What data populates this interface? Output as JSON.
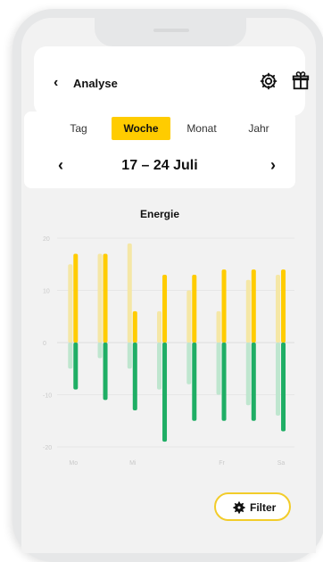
{
  "header": {
    "back_icon": "chevron-left-icon",
    "title": "Analyse",
    "settings_icon": "gear-icon",
    "gift_icon": "gift-icon"
  },
  "tabs": [
    {
      "label": "Tag",
      "active": false
    },
    {
      "label": "Woche",
      "active": true
    },
    {
      "label": "Monat",
      "active": false
    },
    {
      "label": "Jahr",
      "active": false
    }
  ],
  "range": {
    "prev_icon": "chevron-left-icon",
    "label": "17 – 24 Juli",
    "next_icon": "chevron-right-icon"
  },
  "chart_data": {
    "type": "bar",
    "title": "Energie",
    "yticks": [
      20,
      10,
      0,
      -10,
      -20
    ],
    "ylim": [
      -20,
      20
    ],
    "xlabels": [
      "Mo",
      "",
      "Mi",
      "",
      "",
      "Fr",
      "",
      "Sa"
    ],
    "categories": [
      "1",
      "2",
      "3",
      "4",
      "5",
      "6",
      "7",
      "8"
    ],
    "series": [
      {
        "values": [
          17,
          17,
          6,
          13,
          13,
          14,
          14,
          14
        ],
        "color": "#ffcc00"
      },
      {
        "values": [
          -9,
          -11,
          -13,
          -19,
          -15,
          -15,
          -15,
          -17
        ],
        "color": "#1fae65"
      }
    ],
    "ghost_series": [
      {
        "values": [
          15,
          17,
          19,
          6,
          10,
          6,
          12,
          13
        ],
        "color": "#f5e7a6"
      },
      {
        "values": [
          -5,
          -3,
          -5,
          -9,
          -8,
          -10,
          -12,
          -14
        ],
        "color": "#bfe6cf"
      }
    ],
    "grid": true
  },
  "filter": {
    "label": "Filter",
    "icon": "gear-icon"
  },
  "colors": {
    "accent": "#ffcc00",
    "positive": "#ffcc00",
    "negative": "#1fae65"
  }
}
